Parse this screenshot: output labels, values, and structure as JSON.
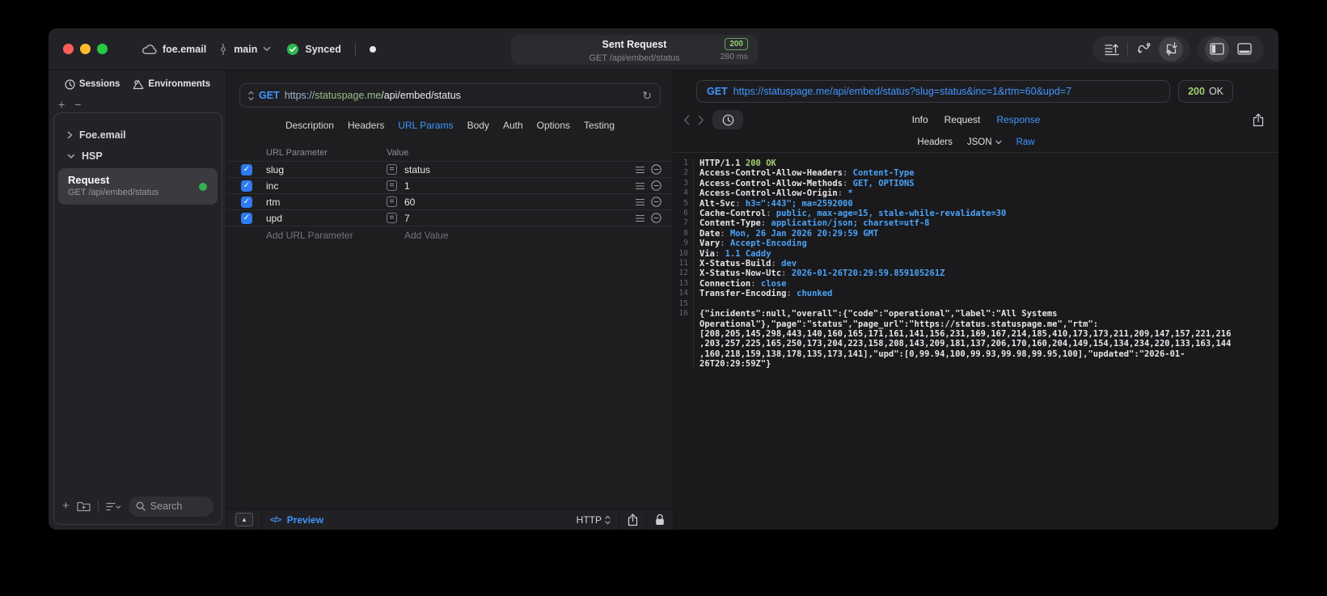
{
  "colors": {
    "accent_blue": "#3f96ff",
    "status_green": "#9ed06d",
    "sync_check_green": "#2fb850",
    "checkbox_blue": "#2f7bf0",
    "request_dot_green": "#32b14e"
  },
  "titlebar": {
    "project_label": "foe.email",
    "branch_label": "main",
    "sync_label": "Synced",
    "request_summary": {
      "title": "Sent Request",
      "method_path": "GET /api/embed/status",
      "status_code": "200",
      "duration": "280 ms"
    }
  },
  "sidebar": {
    "tab_sessions": "Sessions",
    "tab_environments": "Environments",
    "tree_item_collapsed": "Foe.email",
    "tree_item_expanded": "HSP",
    "request_item": {
      "title": "Request",
      "subtitle": "GET /api/embed/status"
    },
    "search_placeholder": "Search"
  },
  "request_editor": {
    "method": "GET",
    "url_scheme": "https://",
    "url_host": "statuspage.me",
    "url_path": "/api/embed/status",
    "tabs": [
      "Description",
      "Headers",
      "URL Params",
      "Body",
      "Auth",
      "Options",
      "Testing"
    ],
    "active_tab": "URL Params",
    "params": {
      "col_name": "URL Parameter",
      "col_value": "Value",
      "rows": [
        {
          "name": "slug",
          "value": "status",
          "enabled": true
        },
        {
          "name": "inc",
          "value": "1",
          "enabled": true
        },
        {
          "name": "rtm",
          "value": "60",
          "enabled": true
        },
        {
          "name": "upd",
          "value": "7",
          "enabled": true
        }
      ],
      "add_name": "Add URL Parameter",
      "add_value": "Add Value"
    },
    "footer": {
      "code_glyph": "</>",
      "preview_label": "Preview",
      "protocol": "HTTP"
    }
  },
  "response_viewer": {
    "method": "GET",
    "url": "https://statuspage.me/api/embed/status?slug=status&inc=1&rtm=60&upd=7",
    "status_code": "200",
    "status_text": "OK",
    "tabs": [
      "Info",
      "Request",
      "Response"
    ],
    "active_tab": "Response",
    "subtabs": [
      "Headers",
      "JSON",
      "Raw"
    ],
    "active_subtab": "Raw",
    "json_subtab_has_dropdown": true,
    "raw_lines": [
      {
        "line": 1,
        "kind": "status",
        "name": "HTTP/1.1",
        "value": "200 OK"
      },
      {
        "line": 2,
        "kind": "header",
        "name": "Access-Control-Allow-Headers",
        "value": "Content-Type"
      },
      {
        "line": 3,
        "kind": "header",
        "name": "Access-Control-Allow-Methods",
        "value": "GET, OPTIONS"
      },
      {
        "line": 4,
        "kind": "header",
        "name": "Access-Control-Allow-Origin",
        "value": "*"
      },
      {
        "line": 5,
        "kind": "header",
        "name": "Alt-Svc",
        "value": "h3=\":443\"; ma=2592000"
      },
      {
        "line": 6,
        "kind": "header",
        "name": "Cache-Control",
        "value": "public, max-age=15, stale-while-revalidate=30"
      },
      {
        "line": 7,
        "kind": "header",
        "name": "Content-Type",
        "value": "application/json; charset=utf-8"
      },
      {
        "line": 8,
        "kind": "header",
        "name": "Date",
        "value": "Mon, 26 Jan 2026 20:29:59 GMT"
      },
      {
        "line": 9,
        "kind": "header",
        "name": "Vary",
        "value": "Accept-Encoding"
      },
      {
        "line": 10,
        "kind": "header",
        "name": "Via",
        "value": "1.1 Caddy"
      },
      {
        "line": 11,
        "kind": "header",
        "name": "X-Status-Build",
        "value": "dev"
      },
      {
        "line": 12,
        "kind": "header",
        "name": "X-Status-Now-Utc",
        "value": "2026-01-26T20:29:59.859105261Z"
      },
      {
        "line": 13,
        "kind": "header",
        "name": "Connection",
        "value": "close"
      },
      {
        "line": 14,
        "kind": "header",
        "name": "Transfer-Encoding",
        "value": "chunked"
      },
      {
        "line": 15,
        "kind": "blank"
      },
      {
        "line": 16,
        "kind": "body",
        "text": "{\"incidents\":null,\"overall\":{\"code\":\"operational\",\"label\":\"All Systems Operational\"},\"page\":\"status\",\"page_url\":\"https://status.statuspage.me\",\"rtm\":[208,205,145,298,443,140,160,165,171,161,141,156,231,169,167,214,185,410,173,173,211,209,147,157,221,216,203,257,225,165,250,173,204,223,158,208,143,209,181,137,206,170,160,204,149,154,134,234,220,133,163,144,160,218,159,138,178,135,173,141],\"upd\":[0,99.94,100,99.93,99.98,99.95,100],\"updated\":\"2026-01-26T20:29:59Z\"}"
      }
    ]
  }
}
